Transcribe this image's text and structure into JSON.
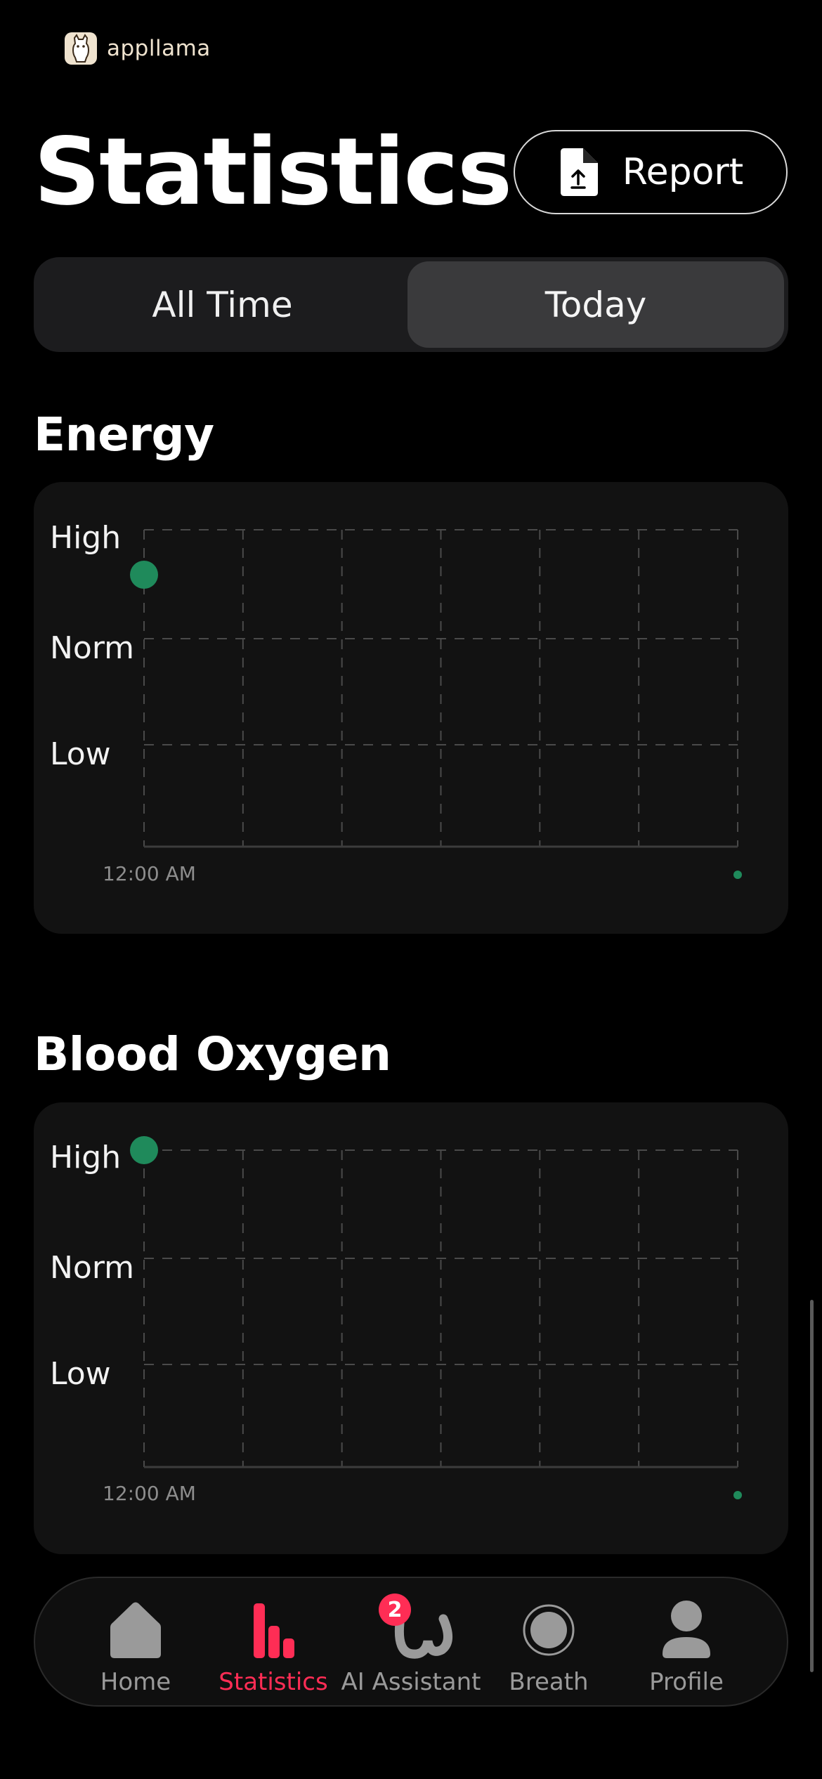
{
  "brand": {
    "name": "appllama"
  },
  "header": {
    "title": "Statistics",
    "report_label": "Report"
  },
  "range_tabs": {
    "all_time": "All Time",
    "today": "Today",
    "selected": "Today"
  },
  "energy": {
    "title": "Energy",
    "y_labels": [
      "High",
      "Norm",
      "Low"
    ],
    "x_start": "12:00 AM"
  },
  "blood_oxygen": {
    "title": "Blood Oxygen",
    "y_labels": [
      "High",
      "Norm",
      "Low"
    ],
    "x_start": "12:00 AM"
  },
  "chart_data": [
    {
      "type": "scatter",
      "title": "Energy",
      "y_categories": [
        "Low",
        "Norm",
        "High"
      ],
      "points": [
        {
          "x": "12:00 AM",
          "y": "High"
        }
      ],
      "x_tick_labels": [
        "12:00 AM"
      ],
      "grid": true,
      "point_color": "#1f8a5b"
    },
    {
      "type": "scatter",
      "title": "Blood Oxygen",
      "y_categories": [
        "Low",
        "Norm",
        "High"
      ],
      "points": [
        {
          "x": "12:00 AM",
          "y": "High"
        }
      ],
      "x_tick_labels": [
        "12:00 AM"
      ],
      "grid": true,
      "point_color": "#1f8a5b"
    }
  ],
  "nav": {
    "items": [
      {
        "label": "Home",
        "icon": "home-icon"
      },
      {
        "label": "Statistics",
        "icon": "bar-chart-icon"
      },
      {
        "label": "AI Assistant",
        "icon": "assistant-icon",
        "badge": "2"
      },
      {
        "label": "Breath",
        "icon": "breath-icon"
      },
      {
        "label": "Profile",
        "icon": "profile-icon"
      }
    ],
    "active": "Statistics"
  },
  "colors": {
    "accent": "#ff2d55",
    "point": "#1f8a5b",
    "background": "#000000",
    "card": "#121212"
  }
}
